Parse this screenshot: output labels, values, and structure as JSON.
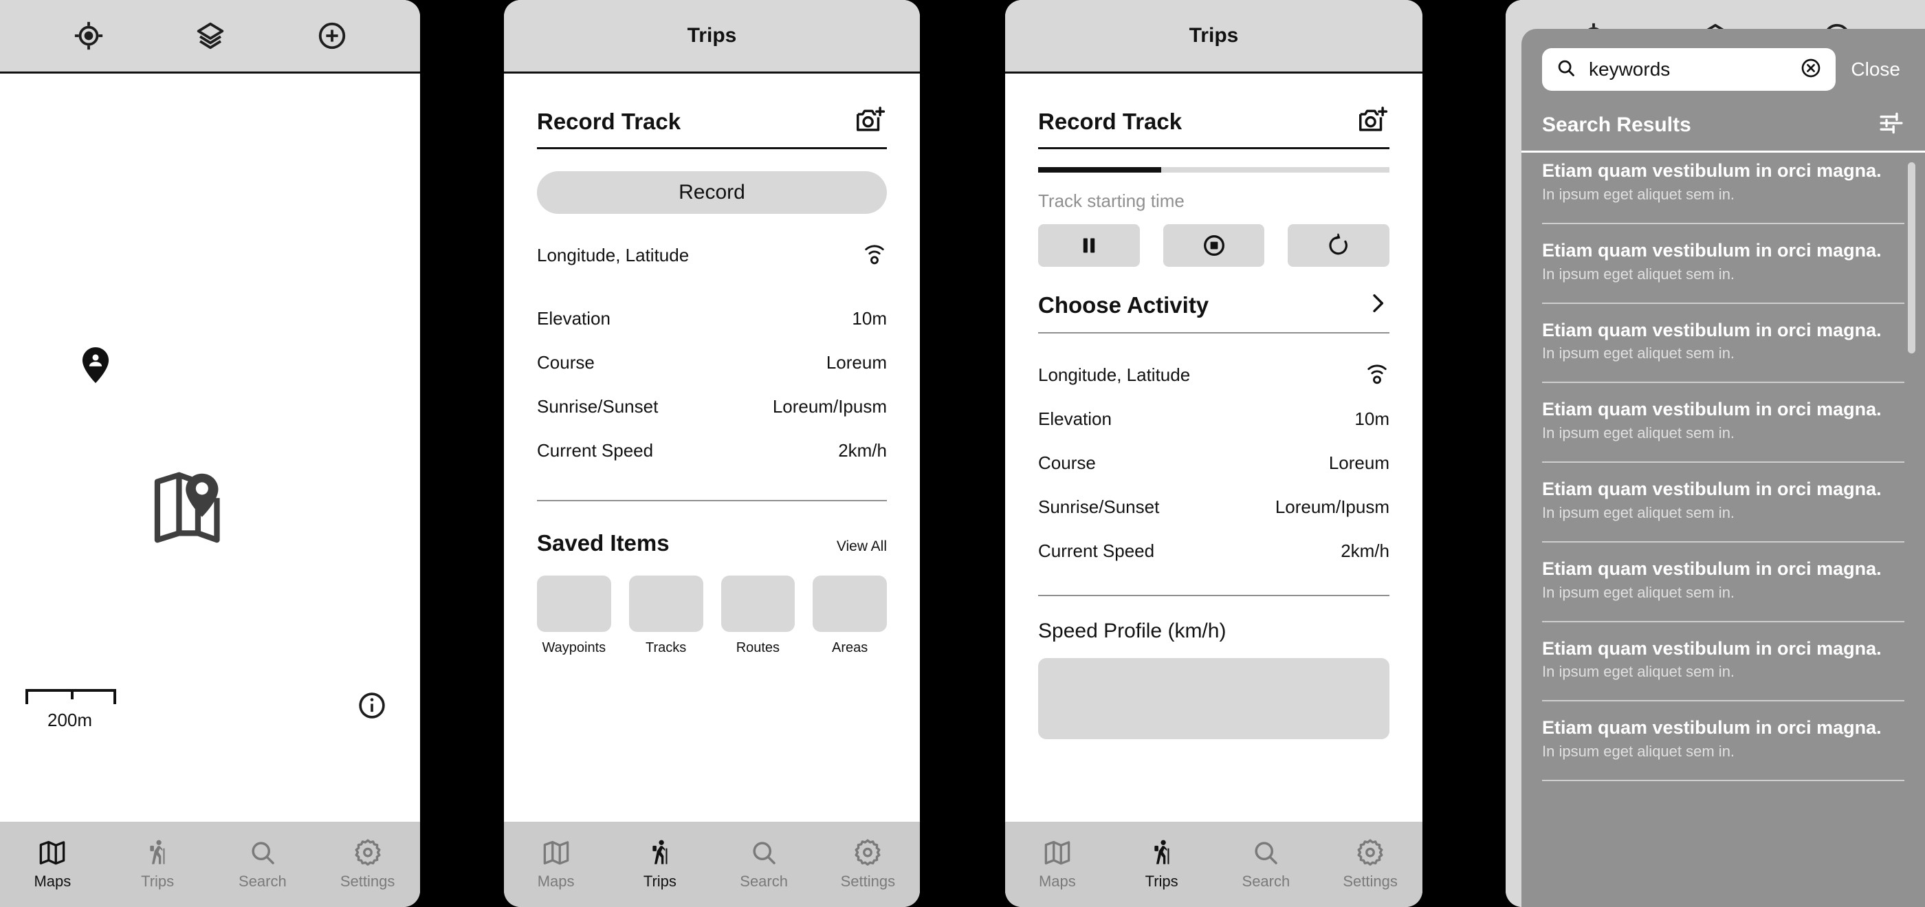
{
  "app": {
    "accent": "#111111",
    "panel_bg": "#ffffff",
    "chrome_bg": "#d8d8d8",
    "tabbar_bg": "#cbcbcb",
    "overlay_bg": "#919191",
    "muted_text": "#8f8f8f"
  },
  "tabbar": {
    "items": [
      {
        "label": "Maps",
        "icon": "map-icon"
      },
      {
        "label": "Trips",
        "icon": "hiker-icon"
      },
      {
        "label": "Search",
        "icon": "search-icon"
      },
      {
        "label": "Settings",
        "icon": "gear-icon"
      }
    ]
  },
  "map_panel": {
    "toolbar": [
      {
        "icon": "locate-target-icon"
      },
      {
        "icon": "layers-icon"
      },
      {
        "icon": "plus-circle-icon"
      }
    ],
    "markers": [
      {
        "icon": "user-location-pin-icon"
      },
      {
        "icon": "map-placeholder-icon"
      }
    ],
    "scale_label": "200m",
    "info_icon": "info-circle-icon",
    "active_tab": "Maps"
  },
  "trips_idle": {
    "nav_title": "Trips",
    "section_title": "Record Track",
    "camera_icon": "camera-add-icon",
    "record_button": "Record",
    "rows": [
      {
        "key": "Longitude, Latitude",
        "value": "",
        "icon": "gps-signal-icon"
      },
      {
        "key": "Elevation",
        "value": "10m"
      },
      {
        "key": "Course",
        "value": "Loreum"
      },
      {
        "key": "Sunrise/Sunset",
        "value": "Loreum/Ipusm"
      },
      {
        "key": "Current Speed",
        "value": "2km/h"
      }
    ],
    "saved_items": {
      "title": "Saved Items",
      "view_all": "View All",
      "tiles": [
        {
          "caption": "Waypoints"
        },
        {
          "caption": "Tracks"
        },
        {
          "caption": "Routes"
        },
        {
          "caption": "Areas"
        }
      ]
    },
    "active_tab": "Trips"
  },
  "trips_recording": {
    "nav_title": "Trips",
    "section_title": "Record Track",
    "camera_icon": "camera-add-icon",
    "progress_percent": 35,
    "start_time_label": "Track starting time",
    "controls": [
      {
        "name": "pause-button",
        "icon": "pause-icon"
      },
      {
        "name": "stop-button",
        "icon": "stop-circle-icon"
      },
      {
        "name": "reset-button",
        "icon": "refresh-icon"
      }
    ],
    "choose_activity": "Choose Activity",
    "chevron_icon": "chevron-right-icon",
    "rows": [
      {
        "key": "Longitude, Latitude",
        "value": "",
        "icon": "gps-signal-icon"
      },
      {
        "key": "Elevation",
        "value": "10m"
      },
      {
        "key": "Course",
        "value": "Loreum"
      },
      {
        "key": "Sunrise/Sunset",
        "value": "Loreum/Ipusm"
      },
      {
        "key": "Current Speed",
        "value": "2km/h"
      }
    ],
    "speed_profile_title": "Speed Profile (km/h)",
    "active_tab": "Trips"
  },
  "search_panel": {
    "toolbar": [
      {
        "icon": "locate-target-icon"
      },
      {
        "icon": "layers-icon"
      },
      {
        "icon": "plus-circle-icon"
      }
    ],
    "search": {
      "value": "keywords",
      "placeholder": "keywords",
      "search_icon": "search-icon",
      "clear_icon": "clear-circle-icon",
      "close_label": "Close"
    },
    "results_header": {
      "title": "Search Results",
      "filter_icon": "filter-sliders-icon"
    },
    "results": [
      {
        "title": "Etiam quam vestibulum in orci magna.",
        "subtitle": "In ipsum eget aliquet sem in."
      },
      {
        "title": "Etiam quam vestibulum in orci magna.",
        "subtitle": "In ipsum eget aliquet sem in."
      },
      {
        "title": "Etiam quam vestibulum in orci magna.",
        "subtitle": "In ipsum eget aliquet sem in."
      },
      {
        "title": "Etiam quam vestibulum in orci magna.",
        "subtitle": "In ipsum eget aliquet sem in."
      },
      {
        "title": "Etiam quam vestibulum in orci magna.",
        "subtitle": "In ipsum eget aliquet sem in."
      },
      {
        "title": "Etiam quam vestibulum in orci magna.",
        "subtitle": "In ipsum eget aliquet sem in."
      },
      {
        "title": "Etiam quam vestibulum in orci magna.",
        "subtitle": "In ipsum eget aliquet sem in."
      },
      {
        "title": "Etiam quam vestibulum in orci magna.",
        "subtitle": "In ipsum eget aliquet sem in."
      }
    ]
  }
}
